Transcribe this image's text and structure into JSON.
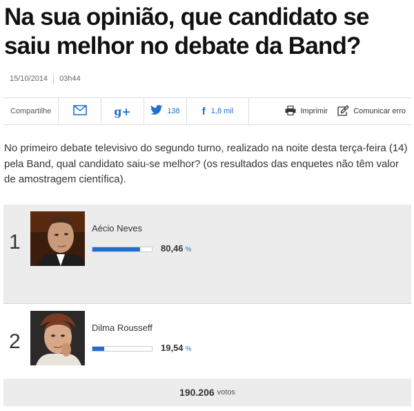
{
  "article": {
    "title": "Na sua opinião, que candidato se saiu melhor no debate da Band?",
    "date": "15/10/2014",
    "time": "03h44",
    "body": "No primeiro debate televisivo do segundo turno, realizado na noite desta terça-feira (14) pela Band, qual candidato saiu-se melhor? (os resultados das enquetes não têm valor de amostragem científica)."
  },
  "share_bar": {
    "label": "Compartilhe",
    "email_icon": "email-icon",
    "gplus_icon": "google-plus-icon",
    "gplus_glyph": "g+",
    "twitter_icon": "twitter-bird-icon",
    "twitter_count": "138",
    "facebook_icon": "facebook-icon",
    "facebook_glyph": "f",
    "facebook_count": "1,8 mil",
    "print_icon": "printer-icon",
    "print_label": "Imprimir",
    "report_icon": "report-error-icon",
    "report_label": "Comunicar erro"
  },
  "poll": {
    "candidates": [
      {
        "rank": "1",
        "name": "Aécio Neves",
        "percent": "80,46",
        "unit": "%",
        "fraction": 0.8046
      },
      {
        "rank": "2",
        "name": "Dilma Rousseff",
        "percent": "19,54",
        "unit": "%",
        "fraction": 0.1954
      }
    ],
    "total_votes": "190.206",
    "votes_label": "votos"
  },
  "colors": {
    "accent": "#1f6fd1",
    "panel_bg": "#ececec"
  }
}
